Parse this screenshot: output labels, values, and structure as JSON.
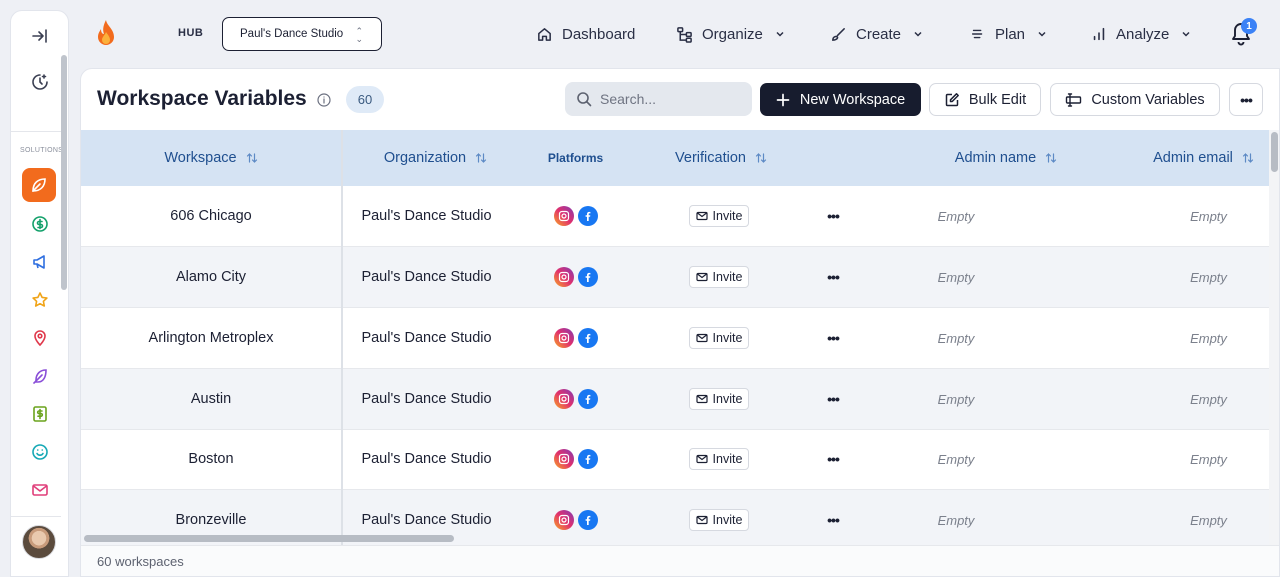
{
  "sidebar": {
    "solutions_label": "SOLUTIONS",
    "icons": [
      "collapse-sidebar-icon",
      "moon-clock-icon",
      "leaf-icon",
      "dollar-circle-icon",
      "megaphone-icon",
      "star-icon",
      "map-pin-icon",
      "feather-icon",
      "dollar-square-icon",
      "smile-icon",
      "mail-icon"
    ]
  },
  "header": {
    "hub_label": "HUB",
    "studio_select": "Paul's Dance Studio",
    "nav": {
      "dashboard": "Dashboard",
      "organize": "Organize",
      "create": "Create",
      "plan": "Plan",
      "analyze": "Analyze"
    },
    "notifications_count": "1"
  },
  "toolbar": {
    "title": "Workspace Variables",
    "count": "60",
    "search_placeholder": "Search...",
    "new_workspace": "New Workspace",
    "bulk_edit": "Bulk Edit",
    "custom_variables": "Custom Variables"
  },
  "table": {
    "columns": {
      "workspace": "Workspace",
      "organization": "Organization",
      "platforms": "Platforms",
      "verification": "Verification",
      "admin_name": "Admin name",
      "admin_email": "Admin email"
    },
    "rows": [
      {
        "workspace": "606 Chicago",
        "organization": "Paul's Dance Studio",
        "verification": "Invite",
        "admin_name": "Empty",
        "admin_email": "Empty"
      },
      {
        "workspace": "Alamo City",
        "organization": "Paul's Dance Studio",
        "verification": "Invite",
        "admin_name": "Empty",
        "admin_email": "Empty"
      },
      {
        "workspace": "Arlington Metroplex",
        "organization": "Paul's Dance Studio",
        "verification": "Invite",
        "admin_name": "Empty",
        "admin_email": "Empty"
      },
      {
        "workspace": "Austin",
        "organization": "Paul's Dance Studio",
        "verification": "Invite",
        "admin_name": "Empty",
        "admin_email": "Empty"
      },
      {
        "workspace": "Boston",
        "organization": "Paul's Dance Studio",
        "verification": "Invite",
        "admin_name": "Empty",
        "admin_email": "Empty"
      },
      {
        "workspace": "Bronzeville",
        "organization": "Paul's Dance Studio",
        "verification": "Invite",
        "admin_name": "Empty",
        "admin_email": "Empty"
      }
    ]
  },
  "footer": {
    "summary": "60 workspaces"
  },
  "colors": {
    "accent": "#f26b1d",
    "primary_button": "#171c2e",
    "header_row": "#d5e3f3",
    "header_text": "#1f4f8f"
  }
}
